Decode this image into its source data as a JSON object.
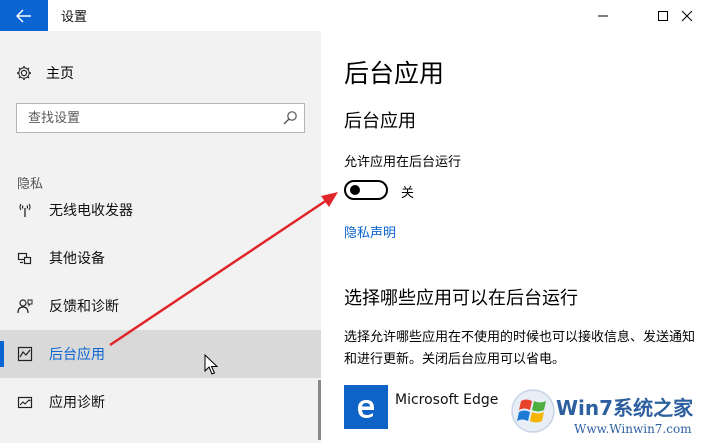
{
  "window": {
    "title": "设置"
  },
  "sidebar": {
    "home_label": "主页",
    "search_placeholder": "查找设置",
    "section_label": "隐私",
    "items": [
      {
        "label": "无线电收发器",
        "icon": "radio-icon"
      },
      {
        "label": "其他设备",
        "icon": "devices-icon"
      },
      {
        "label": "反馈和诊断",
        "icon": "feedback-icon"
      },
      {
        "label": "后台应用",
        "icon": "background-apps-icon",
        "active": true
      },
      {
        "label": "应用诊断",
        "icon": "app-diagnostics-icon"
      }
    ]
  },
  "main": {
    "title": "后台应用",
    "section_heading": "后台应用",
    "toggle_caption": "允许应用在后台运行",
    "toggle_state": "关",
    "toggle_on": false,
    "privacy_link": "隐私声明",
    "subheading": "选择哪些应用可以在后台运行",
    "description": "选择允许哪些应用在不使用的时候也可以接收信息、发送通知和进行更新。关闭后台应用可以省电。",
    "apps": [
      {
        "name": "Microsoft Edge",
        "icon": "edge-icon"
      }
    ]
  },
  "watermark": {
    "brand": "Win7系统之家",
    "url": "Www.Winwin7.com"
  },
  "colors": {
    "accent": "#0a64d2",
    "sidebar_bg": "#f2f2f2",
    "active_item_bg": "#d9d9d9",
    "annotation_arrow": "#e0262a"
  }
}
